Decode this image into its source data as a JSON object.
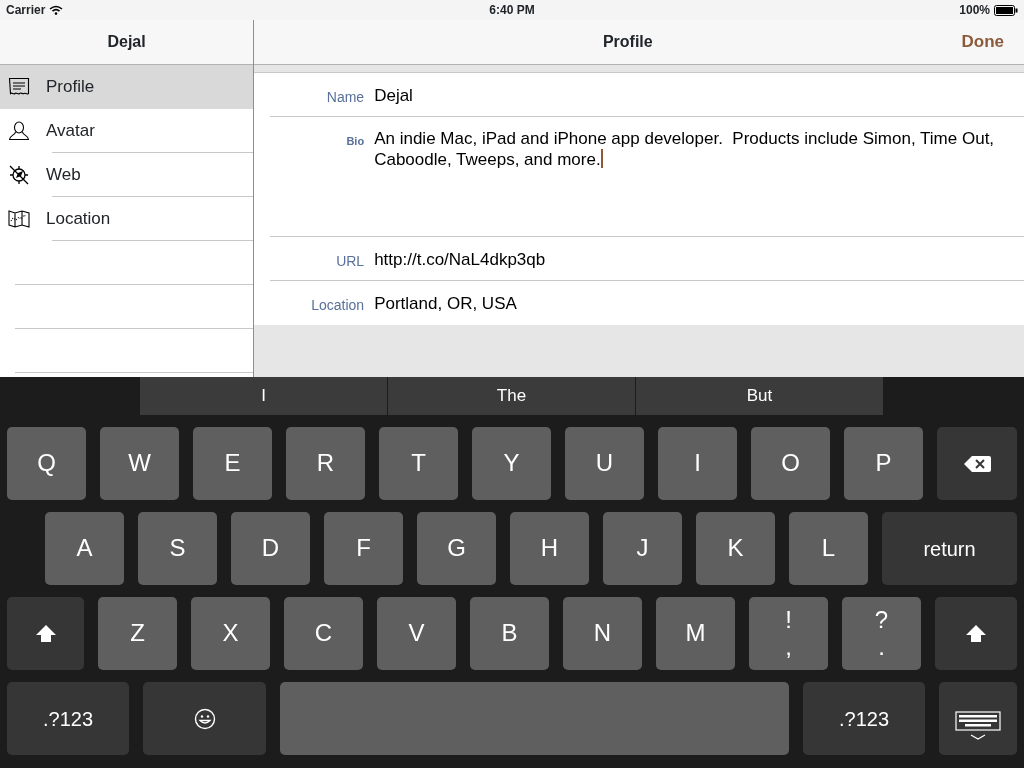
{
  "status_bar": {
    "carrier": "Carrier",
    "time": "6:40 PM",
    "battery": "100%"
  },
  "sidebar": {
    "title": "Dejal",
    "items": [
      {
        "label": "Profile",
        "selected": true
      },
      {
        "label": "Avatar",
        "selected": false
      },
      {
        "label": "Web",
        "selected": false
      },
      {
        "label": "Location",
        "selected": false
      }
    ]
  },
  "detail": {
    "title": "Profile",
    "done_button": "Done",
    "fields": [
      {
        "label": "Name",
        "kind": "single",
        "value": "Dejal",
        "focused": false
      },
      {
        "label": "Bio",
        "kind": "multiline",
        "value": "An indie Mac, iPad and iPhone app developer.  Products include Simon, Time Out, Caboodle, Tweeps, and more.",
        "focused": true
      },
      {
        "label": "URL",
        "kind": "single",
        "value": "http://t.co/NaL4dkp3qb",
        "focused": false
      },
      {
        "label": "Location",
        "kind": "single",
        "value": "Portland, OR, USA",
        "focused": false
      }
    ]
  },
  "keyboard": {
    "suggestions": [
      "I",
      "The",
      "But"
    ],
    "rows": [
      {
        "keys": [
          {
            "kind": "letter",
            "label": "Q"
          },
          {
            "kind": "letter",
            "label": "W"
          },
          {
            "kind": "letter",
            "label": "E"
          },
          {
            "kind": "letter",
            "label": "R"
          },
          {
            "kind": "letter",
            "label": "T"
          },
          {
            "kind": "letter",
            "label": "Y"
          },
          {
            "kind": "letter",
            "label": "U"
          },
          {
            "kind": "letter",
            "label": "I"
          },
          {
            "kind": "letter",
            "label": "O"
          },
          {
            "kind": "letter",
            "label": "P"
          },
          {
            "kind": "backspace"
          }
        ]
      },
      {
        "keys": [
          {
            "kind": "letter",
            "label": "A"
          },
          {
            "kind": "letter",
            "label": "S"
          },
          {
            "kind": "letter",
            "label": "D"
          },
          {
            "kind": "letter",
            "label": "F"
          },
          {
            "kind": "letter",
            "label": "G"
          },
          {
            "kind": "letter",
            "label": "H"
          },
          {
            "kind": "letter",
            "label": "J"
          },
          {
            "kind": "letter",
            "label": "K"
          },
          {
            "kind": "letter",
            "label": "L"
          },
          {
            "kind": "return",
            "label": "return"
          }
        ]
      },
      {
        "keys": [
          {
            "kind": "shift"
          },
          {
            "kind": "letter",
            "label": "Z"
          },
          {
            "kind": "letter",
            "label": "X"
          },
          {
            "kind": "letter",
            "label": "C"
          },
          {
            "kind": "letter",
            "label": "V"
          },
          {
            "kind": "letter",
            "label": "B"
          },
          {
            "kind": "letter",
            "label": "N"
          },
          {
            "kind": "letter",
            "label": "M"
          },
          {
            "kind": "dual",
            "label": "!",
            "label2": ","
          },
          {
            "kind": "dual",
            "label": "?",
            "label2": "."
          },
          {
            "kind": "shift"
          }
        ]
      },
      {
        "keys": [
          {
            "kind": "numbers",
            "label": ".?123"
          },
          {
            "kind": "emoji"
          },
          {
            "kind": "space"
          },
          {
            "kind": "numbers",
            "label": ".?123"
          },
          {
            "kind": "hide"
          }
        ]
      }
    ]
  }
}
